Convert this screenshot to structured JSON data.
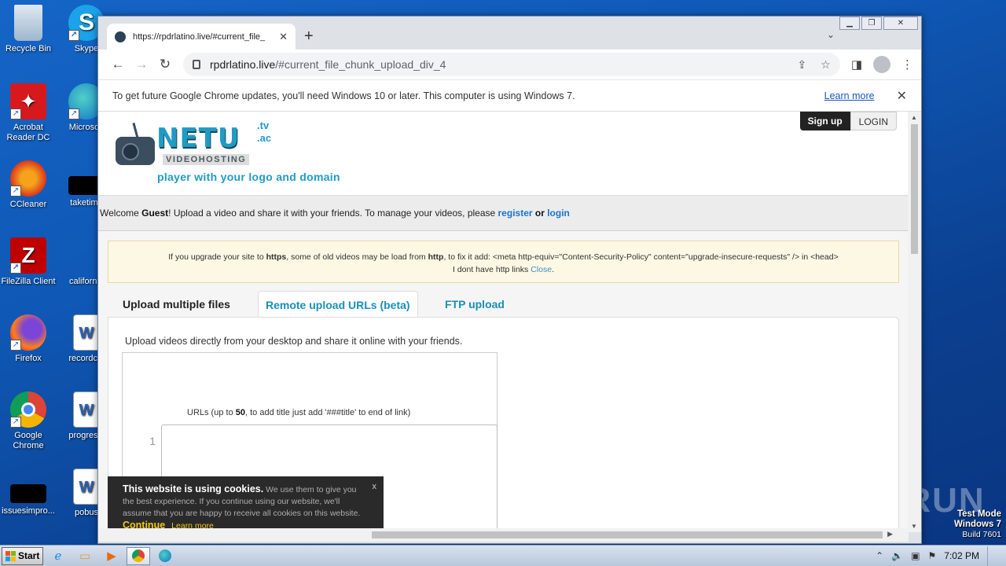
{
  "desktop": {
    "icons": [
      {
        "label": "Recycle Bin",
        "icon": "recycle-bin-icon"
      },
      {
        "label": "Skype",
        "icon": "skype-icon"
      },
      {
        "label": "Acrobat Reader DC",
        "icon": "acrobat-icon"
      },
      {
        "label": "Microsoft",
        "icon": "edge-icon"
      },
      {
        "label": "CCleaner",
        "icon": "ccleaner-icon"
      },
      {
        "label": "taketime",
        "icon": "black-file-icon"
      },
      {
        "label": "FileZilla Client",
        "icon": "filezilla-icon"
      },
      {
        "label": "california",
        "icon": "blank-file-icon"
      },
      {
        "label": "Firefox",
        "icon": "firefox-icon"
      },
      {
        "label": "recordclo",
        "icon": "word-doc-icon"
      },
      {
        "label": "Google Chrome",
        "icon": "chrome-icon"
      },
      {
        "label": "progressi",
        "icon": "word-doc-icon"
      },
      {
        "label": "issuesimpro...",
        "icon": "black-file-icon"
      },
      {
        "label": "pobus",
        "icon": "word-doc-icon"
      }
    ]
  },
  "browser": {
    "tab_title": "https://rpdrlatino.live/#current_file_",
    "url_host": "rpdrlatino.live",
    "url_path": "/#current_file_chunk_upload_div_4",
    "infobar_text": "To get future Google Chrome updates, you'll need Windows 10 or later. This computer is using Windows 7.",
    "infobar_link": "Learn more"
  },
  "page": {
    "logo_name": "NETU",
    "logo_sub": "VIDEOHOSTING",
    "logo_tld1": ".tv",
    "logo_tld2": ".ac",
    "tagline": "player with your logo and domain",
    "signup": "Sign up",
    "login": "LOGIN",
    "welcome_pre": "Welcome ",
    "welcome_guest": "Guest",
    "welcome_mid": "! Upload a video and share it with your friends. To manage your videos, please ",
    "welcome_register": "register",
    "welcome_or": " or ",
    "welcome_login": "login",
    "alert_line1_a": "If you upgrade your site to ",
    "alert_https": "https",
    "alert_line1_b": ", some of old videos may be load from ",
    "alert_http": "http",
    "alert_line1_c": ", to fix it add: <meta http-equiv=\"Content-Security-Policy\" content=\"upgrade-insecure-requests\" /> in <head>",
    "alert_line2": "I dont have http links ",
    "alert_close": "Close",
    "alert_end": ".",
    "tabs": [
      "Upload multiple files",
      "Remote upload URLs (beta)",
      "FTP upload"
    ],
    "lead": "Upload videos directly from your desktop and share it online with your friends.",
    "urls_label_a": "URLs (up to ",
    "urls_label_num": "50",
    "urls_label_b": ", to add title just add '###title' to end of link)",
    "line_number": "1",
    "cookie_head": "This website is using cookies.",
    "cookie_text": " We use them to give you the best experience. If you continue using our website, we'll assume that you are happy to receive all cookies on this website.",
    "cookie_continue": "Continue",
    "cookie_more": "Learn more",
    "cookie_close": "x"
  },
  "taskbar": {
    "start": "Start",
    "clock": "7:02 PM"
  },
  "watermark": {
    "text": "ANY RUN",
    "test_mode": "Test Mode",
    "os": "Windows 7",
    "build": "Build 7601"
  }
}
